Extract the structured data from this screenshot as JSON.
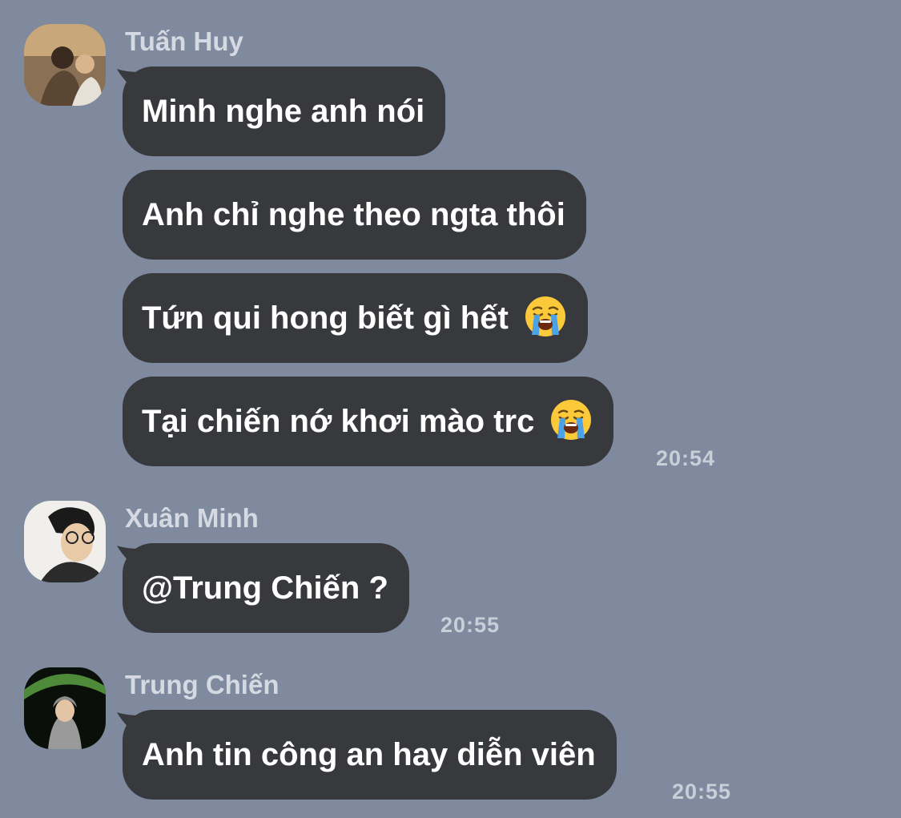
{
  "messages": [
    {
      "sender": "Tuấn Huy",
      "avatar": "avatar-tuan-huy",
      "bubbles": [
        "Minh nghe anh nói",
        "Anh chỉ nghe theo ngta thôi",
        "Tứn qui hong biết gì hết",
        "Tại chiến nớ khơi mào trc"
      ],
      "time": "20:54"
    },
    {
      "sender": "Xuân Minh",
      "avatar": "avatar-xuan-minh",
      "bubbles": [
        "@Trung Chiến ?"
      ],
      "time": "20:55"
    },
    {
      "sender": "Trung Chiến",
      "avatar": "avatar-trung-chien",
      "bubbles": [
        "Anh tin công an hay diễn viên"
      ],
      "time": "20:55"
    }
  ],
  "icons": {
    "crying_emoji": "loudly-crying-face-icon"
  },
  "colors": {
    "background": "#7f8a9e",
    "bubble": "#38393d",
    "bubble_text": "#ffffff",
    "sender_name": "#d4d9e2",
    "timestamp": "#c9cfd9"
  }
}
